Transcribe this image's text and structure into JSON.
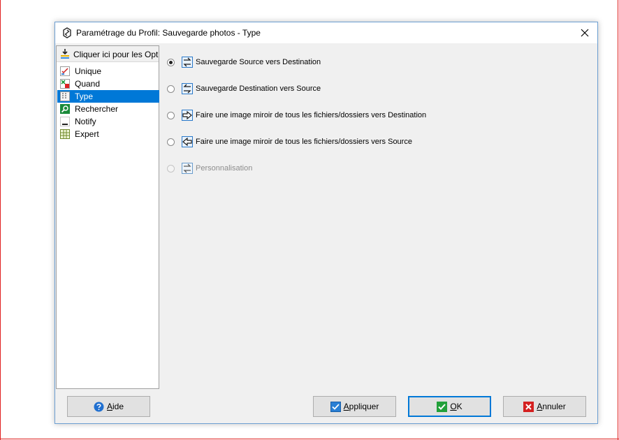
{
  "window": {
    "title": "Paramétrage du Profil: Sauvegarde photos - Type"
  },
  "nav": {
    "header_label": "Cliquer ici pour les Options Simples",
    "items": [
      {
        "label": "Unique",
        "icon": "unique-icon"
      },
      {
        "label": "Quand",
        "icon": "quand-icon"
      },
      {
        "label": "Type",
        "icon": "type-icon",
        "selected": true
      },
      {
        "label": "Rechercher",
        "icon": "search-icon"
      },
      {
        "label": "Notify",
        "icon": "notify-icon"
      },
      {
        "label": "Expert",
        "icon": "expert-icon"
      }
    ]
  },
  "options": [
    {
      "label": "Sauvegarde Source vers Destination",
      "checked": true,
      "enabled": true
    },
    {
      "label": "Sauvegarde Destination vers Source",
      "checked": false,
      "enabled": true
    },
    {
      "label": "Faire une image miroir de tous les fichiers/dossiers vers Destination",
      "checked": false,
      "enabled": true
    },
    {
      "label": "Faire une image miroir de tous les fichiers/dossiers vers Source",
      "checked": false,
      "enabled": true
    },
    {
      "label": "Personnalisation",
      "checked": false,
      "enabled": false
    }
  ],
  "buttons": {
    "help": "Aide",
    "apply": "Appliquer",
    "ok": "OK",
    "cancel": "Annuler"
  },
  "colors": {
    "accent": "#0078d7",
    "dialog_bg": "#f0f0f0",
    "disabled_text": "#8d8d8d",
    "outer_frame": "#e02020"
  }
}
